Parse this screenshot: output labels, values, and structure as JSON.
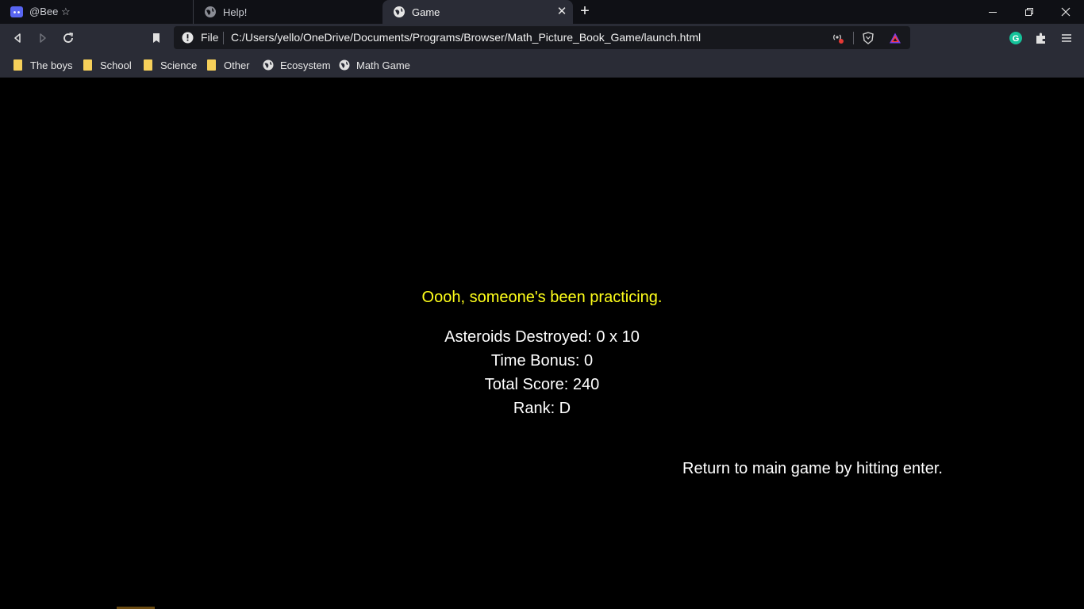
{
  "tabs": [
    {
      "title": "@Bee ☆",
      "icon": "discord-icon"
    },
    {
      "title": "Help!",
      "icon": "globe-icon"
    },
    {
      "title": "Game",
      "icon": "globe-icon",
      "active": true
    }
  ],
  "omnibox": {
    "scheme_label": "File",
    "url": "C:/Users/yello/OneDrive/Documents/Programs/Browser/Math_Picture_Book_Game/launch.html"
  },
  "bookmarks": [
    {
      "label": "The boys",
      "icon": "folder-icon"
    },
    {
      "label": "School",
      "icon": "folder-icon"
    },
    {
      "label": "Science",
      "icon": "folder-icon"
    },
    {
      "label": "Other",
      "icon": "folder-icon"
    },
    {
      "label": "Ecosystem",
      "icon": "globe-icon"
    },
    {
      "label": "Math Game",
      "icon": "globe-icon"
    }
  ],
  "game": {
    "message": "Oooh, someone's been practicing.",
    "asteroids": "Asteroids Destroyed: 0 x 10",
    "time_bonus": "Time Bonus: 0",
    "total_score": "Total Score: 240",
    "rank": "Rank: D",
    "return_hint": "Return to main game by hitting enter."
  },
  "colors": {
    "accent_message": "#ffff1a",
    "page_background": "#000000",
    "toolbar": "#2a2c36"
  }
}
